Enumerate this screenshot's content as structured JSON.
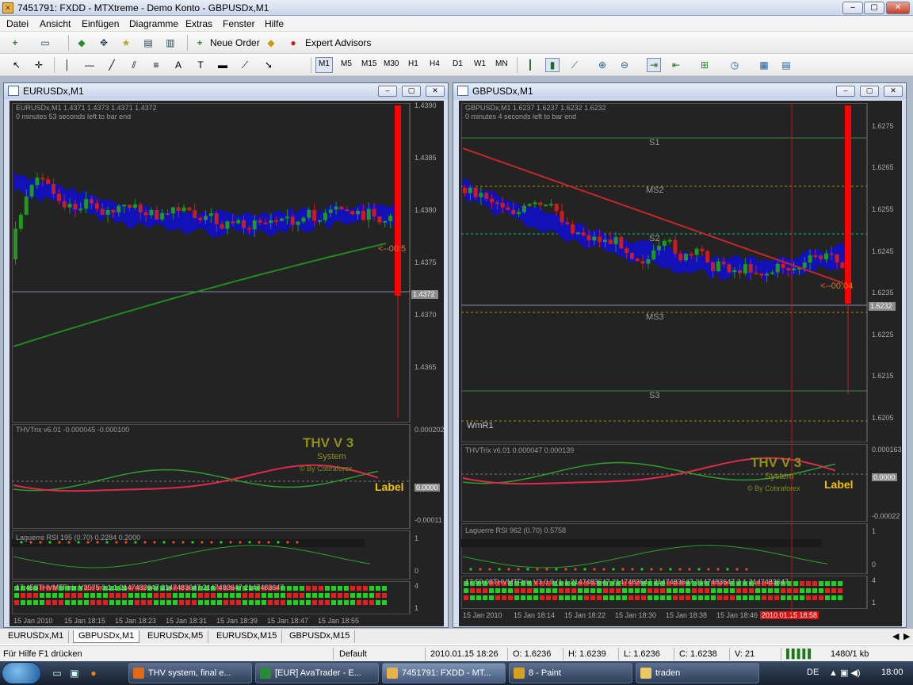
{
  "window": {
    "title": "7451791: FXDD - MTXtreme - Demo Konto - GBPUSDx,M1",
    "min": "–",
    "max": "▢",
    "close": "✕"
  },
  "menu": [
    "Datei",
    "Ansicht",
    "Einfügen",
    "Diagramme",
    "Extras",
    "Fenster",
    "Hilfe"
  ],
  "toolbar": {
    "neue_order": "Neue Order",
    "expert_advisors": "Expert Advisors"
  },
  "timeframes": [
    "M1",
    "M5",
    "M15",
    "M30",
    "H1",
    "H4",
    "D1",
    "W1",
    "MN"
  ],
  "chart_left": {
    "title": "EURUSDx,M1",
    "header_ohlc": "EURUSDx,M1  1.4371 1.4373 1.4371 1.4372",
    "header_timer": "0 minutes 53 seconds left to bar end",
    "price_ticks": [
      "1.4390",
      "1.4385",
      "1.4380",
      "1.4375",
      "1.4372",
      "1.4370",
      "1.4365"
    ],
    "current_price": "1.4372",
    "countdown": "<--00:5",
    "thv_header": "THVTrix v6.01 -0.000045 -0.000100",
    "thv_ticks": [
      "0.000202",
      "0.0000",
      "-0.00011"
    ],
    "thv_logo": "THV V 3",
    "thv_system": "System",
    "thv_by": "© By Cobraforex",
    "label": "Label",
    "laguerre_header": "Laguerre RSI 195 (0.70) 0.2284 0.2000",
    "laguerre_ticks": [
      "1",
      "0"
    ],
    "mtf_header": "17:45STHVMTFtrix V3575  0.1.1 2147483647 2147483647 2147483647 2147483647",
    "mtf_ticks": [
      "4",
      "1"
    ],
    "time_labels": [
      "15 Jan 2010",
      "15 Jan 18:15",
      "15 Jan 18:23",
      "15 Jan 18:31",
      "15 Jan 18:39",
      "15 Jan 18:47",
      "15 Jan 18:55"
    ]
  },
  "chart_right": {
    "title": "GBPUSDx,M1",
    "header_ohlc": "GBPUSDx,M1  1.6237 1.6237 1.6232 1.6232",
    "header_timer": "0 minutes 4 seconds left to bar end",
    "price_ticks": [
      "1.6275",
      "1.6265",
      "1.6255",
      "1.6245",
      "1.6235",
      "1.6232",
      "1.6225",
      "1.6215",
      "1.6205"
    ],
    "current_price": "1.6232",
    "countdown": "<--00:04",
    "levels": [
      "S1",
      "MS2",
      "S2",
      "MS3",
      "S3"
    ],
    "wmr": "WmR1",
    "thv_header": "THVTrix v6.01 0.000047 0.000139",
    "thv_ticks": [
      "0.000163",
      "0.0000",
      "-0.00022"
    ],
    "thv_logo": "THV V 3",
    "thv_system": "System",
    "thv_by": "© By Cobraforex",
    "label": "Label",
    "laguerre_header": "Laguerre RSI 962 (0.70) 0.5758",
    "laguerre_ticks": [
      "1",
      "0"
    ],
    "mtf_header": "17:59:08THVMTFtrix V3 0.9 (1.1 2147483647 2147483647 2147483647 2147483647 2 1 2147483647",
    "mtf_ticks": [
      "4",
      "1"
    ],
    "time_labels": [
      "15 Jan 2010",
      "15 Jan 18:14",
      "15 Jan 18:22",
      "15 Jan 18:30",
      "15 Jan 18:38",
      "15 Jan 18:46"
    ],
    "time_highlight": "2010.01.15 18:58"
  },
  "tabs": [
    "EURUSDx,M1",
    "GBPUSDx,M1",
    "EURUSDx,M5",
    "EURUSDx,M15",
    "GBPUSDx,M15"
  ],
  "status": {
    "help": "Für Hilfe F1 drücken",
    "profile": "Default",
    "datetime": "2010.01.15 18:26",
    "open": "O: 1.6236",
    "high": "H: 1.6239",
    "low": "L: 1.6236",
    "close": "C: 1.6238",
    "volume": "V: 21",
    "traffic": "1480/1 kb"
  },
  "taskbar": {
    "items": [
      {
        "label": "THV system, final e...",
        "color": "#e06a1a"
      },
      {
        "label": "[EUR] AvaTrader - E...",
        "color": "#2a8a3a"
      },
      {
        "label": "7451791: FXDD - MT...",
        "color": "#e8b24a"
      },
      {
        "label": "8 - Paint",
        "color": "#d8a020"
      },
      {
        "label": "traden",
        "color": "#e8c860"
      }
    ],
    "lang": "DE",
    "clock": "18:00"
  },
  "colors": {
    "chart_bg": "#232323",
    "bull": "#1f9a1f",
    "bear": "#c81e1e",
    "cloud": "#1010c8",
    "ma_left": "#1f8c1f",
    "ma_right": "#c02828",
    "bid_bar": "#ff0000",
    "logo": "#8f8f18",
    "label": "#f2c200"
  }
}
